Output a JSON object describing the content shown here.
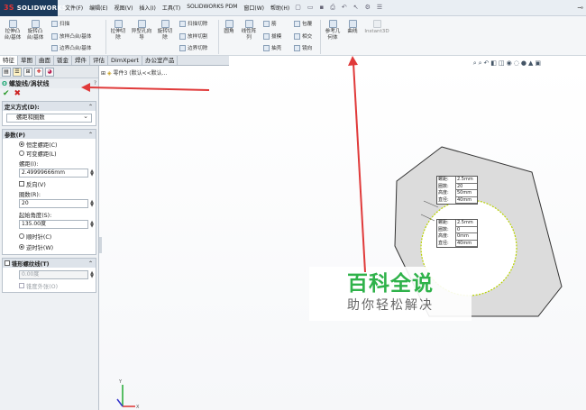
{
  "app": {
    "logo_text": "SOLIDWORKS",
    "menu": [
      "文件(F)",
      "编辑(E)",
      "视图(V)",
      "插入(I)",
      "工具(T)",
      "SOLIDWORKS PDM",
      "窗口(W)",
      "帮助(H)"
    ]
  },
  "ribbon": {
    "extrude_boss": "拉伸凸台/基体",
    "revolve_boss": "旋转凸台/基体",
    "sweep": "扫描",
    "loft_boss": "放样凸台/基体",
    "boundary_boss": "边界凸台/基体",
    "extrude_cut": "拉伸切除",
    "hole_wizard": "异型孔向导",
    "revolve_cut": "旋转切除",
    "sweep_cut": "扫描切除",
    "loft_cut": "放样切割",
    "boundary_cut": "边界切除",
    "fillet": "圆角",
    "linear_pattern": "线性阵列",
    "rib": "筋",
    "draft": "拔模",
    "shell": "抽壳",
    "wrap": "包覆",
    "intersect": "相交",
    "mirror": "镜向",
    "ref_geometry": "参考几何体",
    "curves": "曲线",
    "instant3d": "Instant3D"
  },
  "tabs": [
    "特征",
    "草图",
    "曲面",
    "钣金",
    "焊件",
    "评估",
    "DimXpert",
    "办公室产品"
  ],
  "panel": {
    "title": "螺旋线/涡状线",
    "help_icon": "?",
    "definition_header": "定义方式(D):",
    "definition_value": "螺距和圈数",
    "params_header": "参数(P)",
    "constant_pitch": "恒定螺距(C)",
    "variable_pitch": "可变螺距(L)",
    "pitch_label": "螺距(I):",
    "pitch_value": "2.49999666mm",
    "reverse_label": "反向(V)",
    "revolutions_label": "圈数(R):",
    "revolutions_value": "20",
    "start_angle_label": "起始角度(S):",
    "start_angle_value": "135.00度",
    "clockwise": "顺时针(C)",
    "counterclockwise": "逆时针(W)",
    "taper_header": "锥形螺纹线(T)",
    "taper_value": "0.00度",
    "taper_outward": "锥度外张(O)"
  },
  "viewport": {
    "tree_label": "零件3 (默认<<默认...",
    "callout_top": [
      {
        "k": "螺距:",
        "v": "2.5mm"
      },
      {
        "k": "圈数:",
        "v": "20"
      },
      {
        "k": "高度:",
        "v": "50mm"
      },
      {
        "k": "直径:",
        "v": "40mm"
      }
    ],
    "callout_bottom": [
      {
        "k": "螺距:",
        "v": "2.5mm"
      },
      {
        "k": "圈数:",
        "v": "0"
      },
      {
        "k": "高度:",
        "v": "0mm"
      },
      {
        "k": "直径:",
        "v": "40mm"
      }
    ]
  },
  "watermark": {
    "line1": "百科全说",
    "line2": "助你轻松解决"
  }
}
